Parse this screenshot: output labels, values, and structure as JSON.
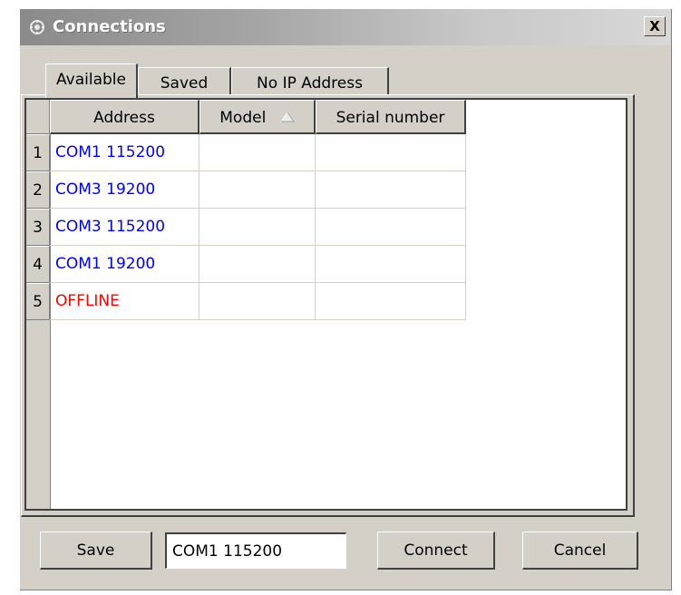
{
  "window": {
    "title": "Connections",
    "close_label": "X"
  },
  "tabs": [
    {
      "label": "Available",
      "active": true
    },
    {
      "label": "Saved",
      "active": false
    },
    {
      "label": "No IP Address",
      "active": false
    }
  ],
  "grid": {
    "columns": [
      "Address",
      "Model",
      "Serial number"
    ],
    "sorted_column": "Model",
    "rows": [
      {
        "num": "1",
        "address": "COM1 115200",
        "model": "",
        "serial": "",
        "status": "available"
      },
      {
        "num": "2",
        "address": "COM3 19200",
        "model": "",
        "serial": "",
        "status": "available"
      },
      {
        "num": "3",
        "address": "COM3 115200",
        "model": "",
        "serial": "",
        "status": "available"
      },
      {
        "num": "4",
        "address": "COM1 19200",
        "model": "",
        "serial": "",
        "status": "available"
      },
      {
        "num": "5",
        "address": "OFFLINE",
        "model": "",
        "serial": "",
        "status": "offline"
      }
    ]
  },
  "footer": {
    "save_label": "Save",
    "address_value": "COM1 115200",
    "connect_label": "Connect",
    "cancel_label": "Cancel"
  },
  "colors": {
    "available_text": "#0000ff",
    "offline_text": "#ff0000"
  }
}
